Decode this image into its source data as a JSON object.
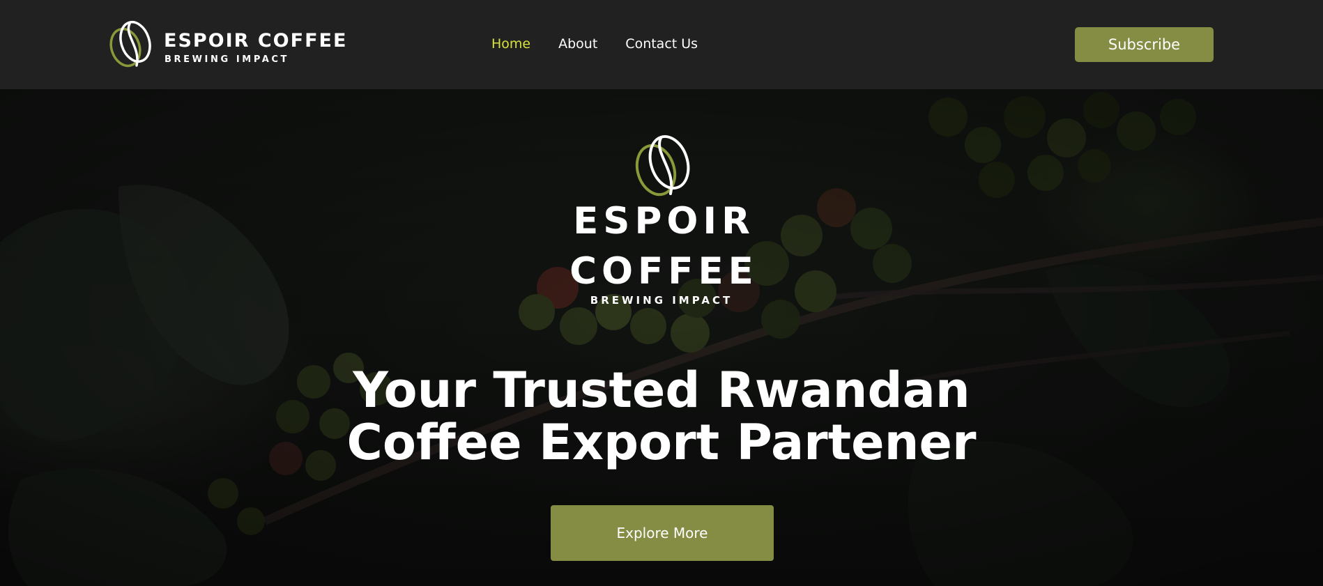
{
  "header": {
    "brand_name": "ESPOIR COFFEE",
    "brand_tagline": "BREWING IMPACT",
    "nav": [
      {
        "label": "Home",
        "active": true
      },
      {
        "label": "About",
        "active": false
      },
      {
        "label": "Contact Us",
        "active": false
      }
    ],
    "subscribe_label": "Subscribe"
  },
  "hero": {
    "brand_line_1": "ESPOIR",
    "brand_line_2": "COFFEE",
    "brand_tagline": "BREWING IMPACT",
    "title_line_1": "Your Trusted Rwandan",
    "title_line_2": "Coffee Export Partener",
    "cta_label": "Explore More",
    "background": "coffee-cherries-photo"
  },
  "colors": {
    "header_bg": "#212121",
    "accent": "#848d43",
    "nav_active": "#d7e23c",
    "logo_green": "#8a9a3a"
  }
}
